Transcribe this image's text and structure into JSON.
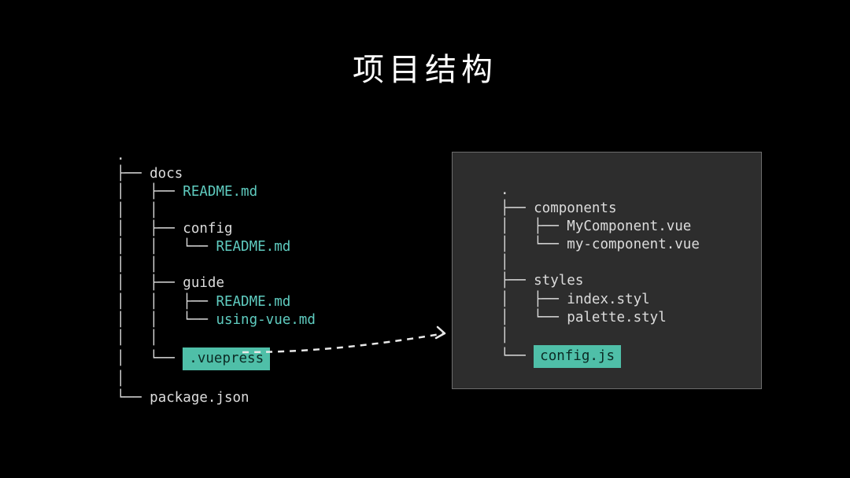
{
  "title": "项目结构",
  "left": {
    "root_dot": ".",
    "l1": "├── docs",
    "l2a": "│   ├── ",
    "l2b": "README.md",
    "l3": "│   │",
    "l4a": "│   ├── ",
    "l4b": "config",
    "l5a": "│   │   └── ",
    "l5b": "README.md",
    "l6": "│   │",
    "l7a": "│   ├── ",
    "l7b": "guide",
    "l8a": "│   │   ├── ",
    "l8b": "README.md",
    "l9a": "│   │   └── ",
    "l9b": "using-vue.md",
    "l10": "│   │",
    "l11a": "│   └── ",
    "l11b": ".vuepress",
    "l12": "│",
    "l13a": "└── ",
    "l13b": "package.json"
  },
  "right": {
    "root_dot": ".",
    "r1": "├── components",
    "r2a": "│   ├── ",
    "r2b": "MyComponent.vue",
    "r3a": "│   └── ",
    "r3b": "my-component.vue",
    "r4": "│",
    "r5": "├── styles",
    "r6a": "│   ├── ",
    "r6b": "index.styl",
    "r7a": "│   └── ",
    "r7b": "palette.styl",
    "r8": "│",
    "r9a": "└── ",
    "r9b": "config.js"
  }
}
